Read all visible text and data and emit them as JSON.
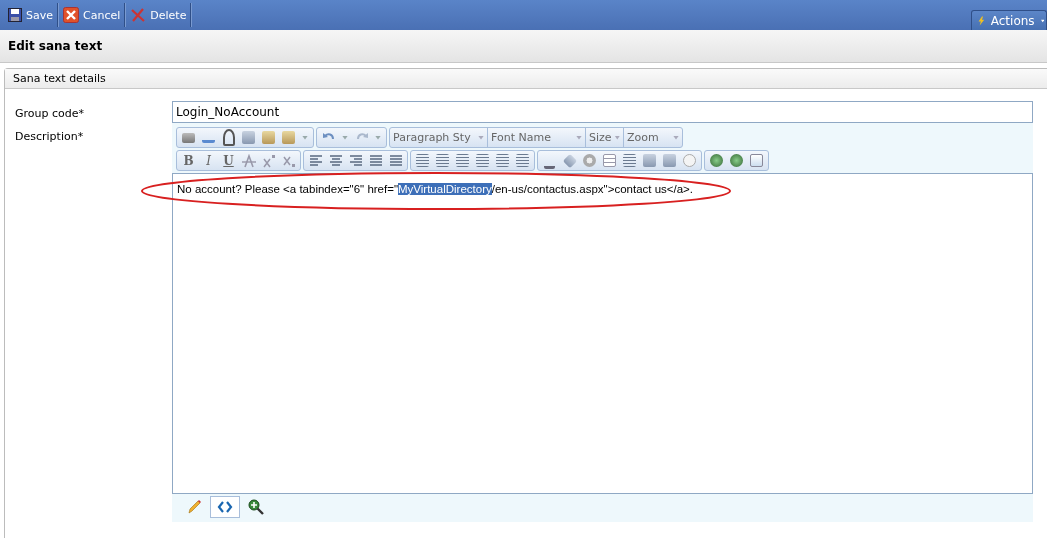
{
  "toolbar": {
    "buttons": [
      {
        "kind": "save",
        "label": "Save"
      },
      {
        "kind": "cancel",
        "label": "Cancel"
      },
      {
        "kind": "delete",
        "label": "Delete"
      }
    ],
    "actions": {
      "label": "Actions"
    }
  },
  "page_title": "Edit sana text",
  "panel": {
    "title": "Sana text details",
    "fields": [
      {
        "label": "Group code*",
        "value": "Login_NoAccount"
      }
    ],
    "description": {
      "label": "Description*",
      "editor": {
        "dropdowns": [
          "Paragraph Sty",
          "Font Name",
          "Size",
          "Zoom"
        ],
        "format_buttons": [
          "B",
          "I",
          "U"
        ],
        "content": [
          {
            "text": "No account? Please <a tabindex=\"6\" href=\"",
            "selected": false
          },
          {
            "text": "MyVirtualDirectory",
            "selected": true
          },
          {
            "text": "/en-us/contactus.aspx\">contact us</a>.",
            "selected": false
          }
        ],
        "modes": [
          {
            "kind": "design",
            "selected": false
          },
          {
            "kind": "html",
            "selected": true
          },
          {
            "kind": "preview",
            "selected": false
          }
        ]
      }
    }
  }
}
